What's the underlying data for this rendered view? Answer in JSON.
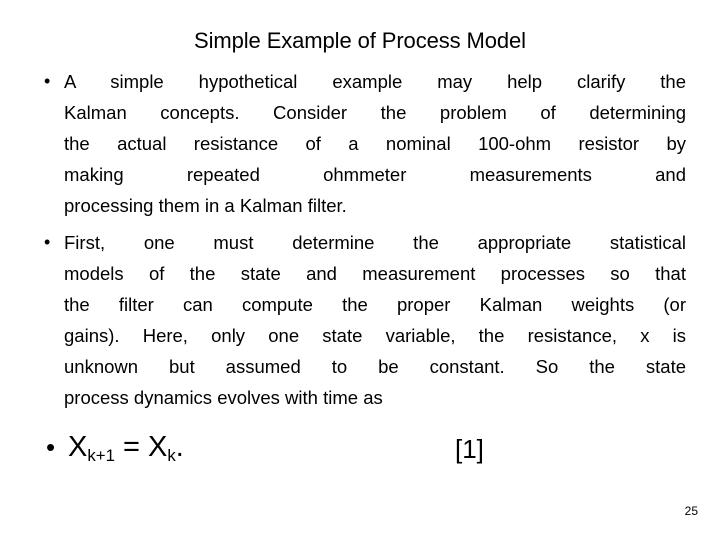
{
  "slide": {
    "title": "Simple Example of Process Model",
    "page_number": "25",
    "bullet_marker": "•",
    "bullets": [
      {
        "marker": "•",
        "lines": [
          "A simple hypothetical example may help clarify the",
          "Kalman concepts. Consider the problem of determining",
          "the actual resistance of a nominal 100-ohm resistor by",
          "making repeated ohmmeter measurements and",
          "processing them in a Kalman filter."
        ],
        "text": "A simple hypothetical example may help clarify the Kalman concepts. Consider the problem of determining the actual resistance of a nominal 100-ohm resistor by making repeated ohmmeter measurements and processing them in a Kalman filter."
      },
      {
        "marker": "•",
        "lines": [
          "First, one must determine the appropriate statistical",
          "models of the state and measurement processes so that",
          "the filter can compute the proper Kalman weights (or",
          "gains). Here, only one state variable, the resistance, x is",
          "unknown but assumed to be constant. So the state",
          "process dynamics evolves with time as"
        ],
        "text": "First, one must determine the appropriate statistical models of the state and measurement processes so that the filter can compute the proper Kalman weights (or gains). Here, only one state variable, the resistance, x is unknown but assumed to be constant. So the state process dynamics evolves with time as"
      }
    ],
    "equation": {
      "marker": "•",
      "lhs_base": "X",
      "lhs_sub": "k+1",
      "operator": " = ",
      "rhs_base": "X",
      "rhs_sub": "k",
      "terminator": ".",
      "tag": "[1]",
      "plain": "Xk+1 = Xk."
    }
  },
  "colors": {
    "background": "#ffffff",
    "text": "#000000"
  }
}
